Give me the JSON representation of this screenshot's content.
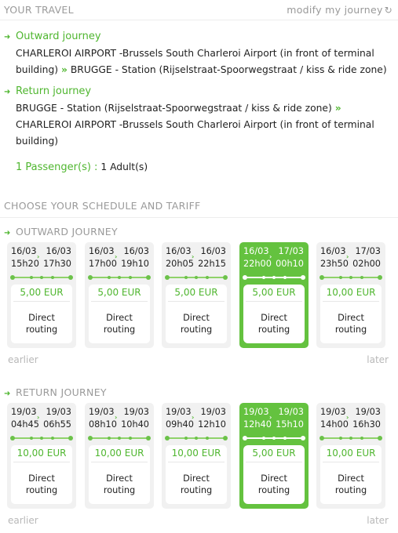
{
  "travel": {
    "title": "YOUR TRAVEL",
    "modify_label": "modify my journey",
    "outward_title": "Outward journey",
    "outward_from": "CHARLEROI AIRPORT -Brussels South Charleroi Airport (in front of terminal building)",
    "outward_to": "BRUGGE - Station (Rijselstraat-Spoorwegstraat / kiss & ride zone)",
    "return_title": "Return journey",
    "return_from": "BRUGGE - Station (Rijselstraat-Spoorwegstraat / kiss & ride zone)",
    "return_to": "CHARLEROI AIRPORT -Brussels South Charleroi Airport (in front of terminal building)",
    "separator": "»",
    "passengers_label": "1 Passenger(s) :",
    "passengers_value": "1 Adult(s)"
  },
  "schedule": {
    "title": "CHOOSE YOUR SCHEDULE AND TARIFF",
    "earlier_label": "earlier",
    "later_label": "later",
    "outward": {
      "label": "OUTWARD JOURNEY",
      "cards": [
        {
          "dep_date": "16/03",
          "arr_date": "16/03",
          "dep_time": "15h20",
          "arr_time": "17h30",
          "price": "5,00 EUR",
          "routing_1": "Direct",
          "routing_2": "routing",
          "selected": false
        },
        {
          "dep_date": "16/03",
          "arr_date": "16/03",
          "dep_time": "17h00",
          "arr_time": "19h10",
          "price": "5,00 EUR",
          "routing_1": "Direct",
          "routing_2": "routing",
          "selected": false
        },
        {
          "dep_date": "16/03",
          "arr_date": "16/03",
          "dep_time": "20h05",
          "arr_time": "22h15",
          "price": "5,00 EUR",
          "routing_1": "Direct",
          "routing_2": "routing",
          "selected": false
        },
        {
          "dep_date": "16/03",
          "arr_date": "17/03",
          "dep_time": "22h00",
          "arr_time": "00h10",
          "price": "5,00 EUR",
          "routing_1": "Direct",
          "routing_2": "routing",
          "selected": true
        },
        {
          "dep_date": "16/03",
          "arr_date": "17/03",
          "dep_time": "23h50",
          "arr_time": "02h00",
          "price": "10,00 EUR",
          "routing_1": "Direct",
          "routing_2": "routing",
          "selected": false
        }
      ]
    },
    "return": {
      "label": "RETURN JOURNEY",
      "cards": [
        {
          "dep_date": "19/03",
          "arr_date": "19/03",
          "dep_time": "04h45",
          "arr_time": "06h55",
          "price": "10,00 EUR",
          "routing_1": "Direct",
          "routing_2": "routing",
          "selected": false
        },
        {
          "dep_date": "19/03",
          "arr_date": "19/03",
          "dep_time": "08h10",
          "arr_time": "10h40",
          "price": "10,00 EUR",
          "routing_1": "Direct",
          "routing_2": "routing",
          "selected": false
        },
        {
          "dep_date": "19/03",
          "arr_date": "19/03",
          "dep_time": "09h40",
          "arr_time": "12h10",
          "price": "10,00 EUR",
          "routing_1": "Direct",
          "routing_2": "routing",
          "selected": false
        },
        {
          "dep_date": "19/03",
          "arr_date": "19/03",
          "dep_time": "12h40",
          "arr_time": "15h10",
          "price": "5,00 EUR",
          "routing_1": "Direct",
          "routing_2": "routing",
          "selected": true
        },
        {
          "dep_date": "19/03",
          "arr_date": "19/03",
          "dep_time": "14h00",
          "arr_time": "16h30",
          "price": "10,00 EUR",
          "routing_1": "Direct",
          "routing_2": "routing",
          "selected": false
        }
      ]
    }
  },
  "colors": {
    "accent": "#64c23f",
    "text_green": "#4fb62f",
    "muted": "#9a9a9a"
  },
  "icons": {
    "leg_arrow": "arrow-right-icon",
    "modify": "refresh-icon"
  }
}
